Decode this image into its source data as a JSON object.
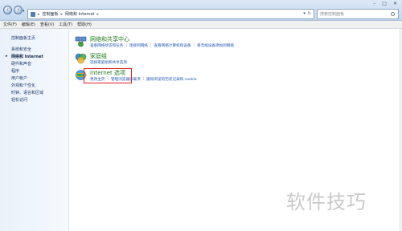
{
  "address_bar": {
    "crumbs": [
      "控制面板",
      "网络和 Internet"
    ],
    "search_placeholder": "搜索控制面板"
  },
  "menu": [
    "文件(F)",
    "编辑(E)",
    "查看(V)",
    "工具(T)",
    "帮助(H)"
  ],
  "left_nav": {
    "items": [
      {
        "label": "控制面板主页",
        "current": false
      },
      {
        "label": "系统和安全",
        "current": false
      },
      {
        "label": "网络和 Internet",
        "current": true
      },
      {
        "label": "硬件和声音",
        "current": false
      },
      {
        "label": "程序",
        "current": false
      },
      {
        "label": "用户帐户",
        "current": false
      },
      {
        "label": "外观和个性化",
        "current": false
      },
      {
        "label": "时钟、语言和区域",
        "current": false
      },
      {
        "label": "轻松访问",
        "current": false
      }
    ]
  },
  "sections": [
    {
      "title": "网络和共享中心",
      "icon": "network-sharing-icon",
      "links": [
        "查看网络状态和任务",
        "连接到网络",
        "查看网络计算机和设备",
        "将无线设备添加到网络"
      ]
    },
    {
      "title": "家庭组",
      "icon": "homegroup-icon",
      "links": [
        "选择家庭组和共享选项"
      ]
    },
    {
      "title": "Internet 选项",
      "icon": "internet-options-icon",
      "links": [
        "更改主页",
        "管理浏览器加载项",
        "删除浏览的历史记录和 cookie"
      ]
    }
  ],
  "watermark": "软件技巧",
  "colors": {
    "section_title": "#1e7a1e",
    "link": "#1f57b5",
    "highlight_box": "#e02020"
  }
}
